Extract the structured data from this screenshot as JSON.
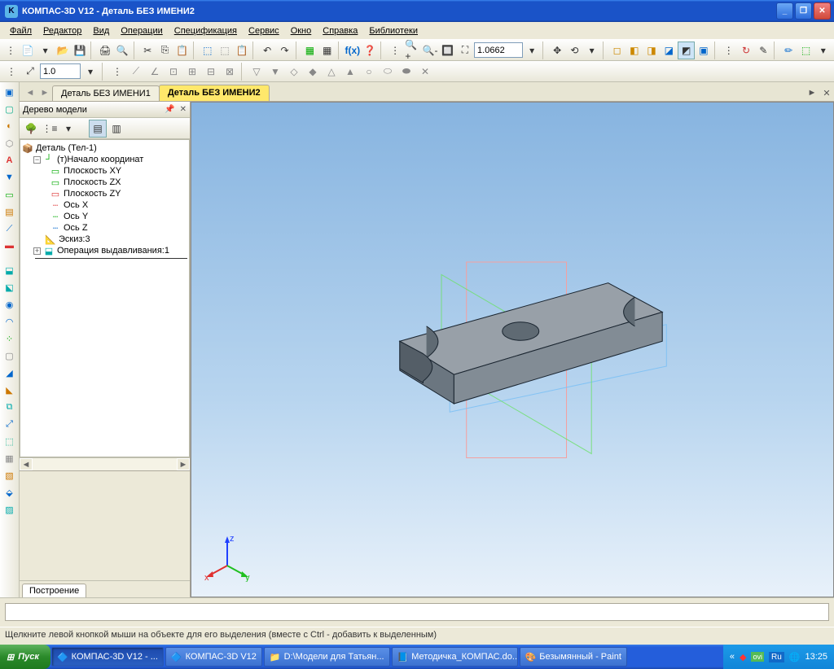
{
  "app": {
    "title": "КОМПАС-3D V12  -  Деталь БЕЗ ИМЕНИ2"
  },
  "menu": [
    "Файл",
    "Редактор",
    "Вид",
    "Операции",
    "Спецификация",
    "Сервис",
    "Окно",
    "Справка",
    "Библиотеки"
  ],
  "toolbar2": {
    "zoom_value": "1.0662",
    "scale_value": "1.0"
  },
  "doc_tabs": {
    "tab1": "Деталь БЕЗ ИМЕНИ1",
    "tab2": "Деталь БЕЗ ИМЕНИ2"
  },
  "tree": {
    "panel_title": "Дерево модели",
    "root": "Деталь (Тел-1)",
    "origin": "(т)Начало координат",
    "plane_xy": "Плоскость XY",
    "plane_zx": "Плоскость ZX",
    "plane_zy": "Плоскость ZY",
    "axis_x": "Ось X",
    "axis_y": "Ось Y",
    "axis_z": "Ось Z",
    "sketch": "Эскиз:3",
    "op": "Операция выдавливания:1",
    "bottom_tab": "Построение"
  },
  "triad": {
    "x": "x",
    "y": "y",
    "z": "z"
  },
  "status": "Щелкните левой кнопкой мыши на объекте для его выделения (вместе с Ctrl - добавить к выделенным)",
  "taskbar": {
    "start": "Пуск",
    "t1": "КОМПАС-3D V12 - ...",
    "t2": "КОМПАС-3D V12",
    "t3": "D:\\Модели для Татьян...",
    "t4": "Методичка_КОМПАС.do...",
    "t5": "Безымянный - Paint",
    "lang": "Ru",
    "time": "13:25"
  }
}
